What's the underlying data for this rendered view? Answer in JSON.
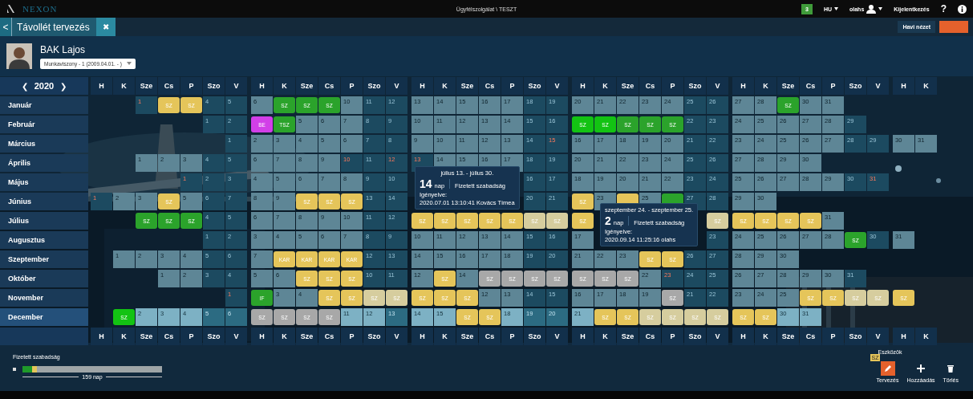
{
  "app": {
    "logo": "NEXON",
    "title": "Ügyfélszolgálat \\ TESZT",
    "notifications": "3",
    "language": "HU",
    "user": "olahs",
    "logout": "Kijelentkezés",
    "help": "?"
  },
  "page_tab": {
    "back": "<",
    "title": "Távollét tervezés",
    "close": "✖"
  },
  "view_button": "Havi nézet",
  "employee": {
    "name": "BAK Lajos",
    "contract": "Munkaviszony - 1 (2009.04.01. - )"
  },
  "year": {
    "prev": "❮",
    "value": "2020",
    "next": "❯"
  },
  "weekdays_top": [
    "H",
    "K",
    "Sze",
    "Cs",
    "P",
    "Szo",
    "V",
    "H",
    "K",
    "Sze",
    "Cs",
    "P",
    "Szo",
    "V",
    "H",
    "K",
    "Sze",
    "Cs",
    "P",
    "Szo",
    "V",
    "H",
    "K",
    "Sze",
    "Cs",
    "P",
    "Szo",
    "V",
    "H",
    "K",
    "Sze",
    "Cs",
    "P",
    "Szo",
    "V",
    "H",
    "K"
  ],
  "weekdays_bottom": [
    "H",
    "K",
    "Sze",
    "Cs",
    "P",
    "Szo",
    "V",
    "H",
    "K",
    "Sze",
    "Cs",
    "P",
    "Szo",
    "V",
    "H",
    "K",
    "Sze",
    "Cs",
    "P",
    "Szo",
    "V",
    "H",
    "K",
    "Sze",
    "Cs",
    "P",
    "Szo",
    "V",
    "H",
    "K",
    "Sze",
    "Cs",
    "P",
    "Szo",
    "V",
    "H",
    "K"
  ],
  "months": [
    {
      "name": "Január",
      "selected": false,
      "days": [
        {
          "kind": "blank"
        },
        {
          "kind": "blank"
        },
        {
          "kind": "holiday",
          "label": "1"
        },
        {
          "kind": "leave",
          "label": "SZ",
          "color": "#e5c55a"
        },
        {
          "kind": "leave",
          "label": "SZ",
          "color": "#e5c55a"
        },
        {
          "kind": "rest",
          "label": "4"
        },
        {
          "kind": "rest",
          "label": "5"
        },
        {
          "kind": "work",
          "label": "6"
        },
        {
          "kind": "leave",
          "label": "SZ",
          "color": "#2ba32b"
        },
        {
          "kind": "leave",
          "label": "SZ",
          "color": "#2ba32b"
        },
        {
          "kind": "leave",
          "label": "SZ",
          "color": "#2ba32b"
        },
        {
          "kind": "work",
          "label": "10"
        },
        {
          "kind": "rest",
          "label": "11"
        },
        {
          "kind": "rest",
          "label": "12"
        },
        {
          "kind": "work",
          "label": "13"
        },
        {
          "kind": "work",
          "label": "14"
        },
        {
          "kind": "work",
          "label": "15"
        },
        {
          "kind": "work",
          "label": "16"
        },
        {
          "kind": "work",
          "label": "17"
        },
        {
          "kind": "rest",
          "label": "18"
        },
        {
          "kind": "rest",
          "label": "19"
        },
        {
          "kind": "work",
          "label": "20"
        },
        {
          "kind": "work",
          "label": "21"
        },
        {
          "kind": "work",
          "label": "22"
        },
        {
          "kind": "work",
          "label": "23"
        },
        {
          "kind": "work",
          "label": "24"
        },
        {
          "kind": "rest",
          "label": "25"
        },
        {
          "kind": "rest",
          "label": "26"
        },
        {
          "kind": "work",
          "label": "27"
        },
        {
          "kind": "work",
          "label": "28"
        },
        {
          "kind": "leave",
          "label": "SZ",
          "color": "#2ba32b"
        },
        {
          "kind": "work",
          "label": "30"
        },
        {
          "kind": "work",
          "label": "31"
        }
      ]
    },
    {
      "name": "Február",
      "selected": false,
      "days": [
        {
          "kind": "blank"
        },
        {
          "kind": "blank"
        },
        {
          "kind": "blank"
        },
        {
          "kind": "blank"
        },
        {
          "kind": "blank"
        },
        {
          "kind": "rest",
          "label": "1"
        },
        {
          "kind": "rest",
          "label": "2"
        },
        {
          "kind": "leave",
          "label": "BE",
          "color": "#d23fe8"
        },
        {
          "kind": "leave",
          "label": "TSZ",
          "color": "#2ba32b"
        },
        {
          "kind": "work",
          "label": "5"
        },
        {
          "kind": "work",
          "label": "6"
        },
        {
          "kind": "work",
          "label": "7"
        },
        {
          "kind": "rest",
          "label": "8"
        },
        {
          "kind": "rest",
          "label": "9"
        },
        {
          "kind": "work",
          "label": "10"
        },
        {
          "kind": "work",
          "label": "11"
        },
        {
          "kind": "work",
          "label": "12"
        },
        {
          "kind": "work",
          "label": "13"
        },
        {
          "kind": "work",
          "label": "14"
        },
        {
          "kind": "rest",
          "label": "15"
        },
        {
          "kind": "rest",
          "label": "16"
        },
        {
          "kind": "leave",
          "label": "SZ",
          "color": "#13c313"
        },
        {
          "kind": "leave",
          "label": "SZ",
          "color": "#13c313"
        },
        {
          "kind": "leave",
          "label": "SZ",
          "color": "#2ba32b"
        },
        {
          "kind": "leave",
          "label": "SZ",
          "color": "#2ba32b"
        },
        {
          "kind": "leave",
          "label": "SZ",
          "color": "#2ba32b"
        },
        {
          "kind": "rest",
          "label": "22"
        },
        {
          "kind": "rest",
          "label": "23"
        },
        {
          "kind": "work",
          "label": "24"
        },
        {
          "kind": "work",
          "label": "25"
        },
        {
          "kind": "work",
          "label": "26"
        },
        {
          "kind": "work",
          "label": "27"
        },
        {
          "kind": "work",
          "label": "28"
        },
        {
          "kind": "rest",
          "label": "29"
        }
      ]
    },
    {
      "name": "Március",
      "selected": false,
      "days": [
        {
          "kind": "blank"
        },
        {
          "kind": "blank"
        },
        {
          "kind": "blank"
        },
        {
          "kind": "blank"
        },
        {
          "kind": "blank"
        },
        {
          "kind": "blank"
        },
        {
          "kind": "rest",
          "label": "1"
        },
        {
          "kind": "work",
          "label": "2"
        },
        {
          "kind": "work",
          "label": "3"
        },
        {
          "kind": "work",
          "label": "4"
        },
        {
          "kind": "work",
          "label": "5"
        },
        {
          "kind": "work",
          "label": "6"
        },
        {
          "kind": "rest",
          "label": "7"
        },
        {
          "kind": "rest",
          "label": "8"
        },
        {
          "kind": "work",
          "label": "9"
        },
        {
          "kind": "work",
          "label": "10"
        },
        {
          "kind": "work",
          "label": "11"
        },
        {
          "kind": "work",
          "label": "12"
        },
        {
          "kind": "work",
          "label": "13"
        },
        {
          "kind": "rest",
          "label": "14"
        },
        {
          "kind": "holiday",
          "label": "15"
        },
        {
          "kind": "work",
          "label": "16"
        },
        {
          "kind": "work",
          "label": "17"
        },
        {
          "kind": "work",
          "label": "18"
        },
        {
          "kind": "work",
          "label": "19"
        },
        {
          "kind": "work",
          "label": "20"
        },
        {
          "kind": "rest",
          "label": "21"
        },
        {
          "kind": "rest",
          "label": "22"
        },
        {
          "kind": "work",
          "label": "23"
        },
        {
          "kind": "work",
          "label": "24"
        },
        {
          "kind": "work",
          "label": "25"
        },
        {
          "kind": "work",
          "label": "26"
        },
        {
          "kind": "work",
          "label": "27"
        },
        {
          "kind": "rest",
          "label": "28"
        },
        {
          "kind": "rest",
          "label": "29"
        },
        {
          "kind": "work",
          "label": "30"
        },
        {
          "kind": "work",
          "label": "31"
        }
      ]
    },
    {
      "name": "Április",
      "selected": false,
      "days": [
        {
          "kind": "blank"
        },
        {
          "kind": "blank"
        },
        {
          "kind": "work",
          "label": "1"
        },
        {
          "kind": "work",
          "label": "2"
        },
        {
          "kind": "work",
          "label": "3"
        },
        {
          "kind": "rest",
          "label": "4"
        },
        {
          "kind": "rest",
          "label": "5"
        },
        {
          "kind": "work",
          "label": "6"
        },
        {
          "kind": "work",
          "label": "7"
        },
        {
          "kind": "work",
          "label": "8"
        },
        {
          "kind": "work",
          "label": "9"
        },
        {
          "kind": "holiday",
          "label": "10"
        },
        {
          "kind": "rest",
          "label": "11"
        },
        {
          "kind": "holiday",
          "label": "12"
        },
        {
          "kind": "holiday",
          "label": "13"
        },
        {
          "kind": "work",
          "label": "14"
        },
        {
          "kind": "work",
          "label": "15"
        },
        {
          "kind": "work",
          "label": "16"
        },
        {
          "kind": "work",
          "label": "17"
        },
        {
          "kind": "rest",
          "label": "18"
        },
        {
          "kind": "rest",
          "label": "19"
        },
        {
          "kind": "work",
          "label": "20"
        },
        {
          "kind": "work",
          "label": "21"
        },
        {
          "kind": "work",
          "label": "22"
        },
        {
          "kind": "work",
          "label": "23"
        },
        {
          "kind": "work",
          "label": "24"
        },
        {
          "kind": "rest",
          "label": "25"
        },
        {
          "kind": "rest",
          "label": "26"
        },
        {
          "kind": "work",
          "label": "27"
        },
        {
          "kind": "work",
          "label": "28"
        },
        {
          "kind": "work",
          "label": "29"
        },
        {
          "kind": "work",
          "label": "30"
        }
      ]
    },
    {
      "name": "Május",
      "selected": false,
      "days": [
        {
          "kind": "blank"
        },
        {
          "kind": "blank"
        },
        {
          "kind": "blank"
        },
        {
          "kind": "blank"
        },
        {
          "kind": "holiday",
          "label": "1"
        },
        {
          "kind": "rest",
          "label": "2"
        },
        {
          "kind": "rest",
          "label": "3"
        },
        {
          "kind": "work",
          "label": "4"
        },
        {
          "kind": "work",
          "label": "5"
        },
        {
          "kind": "work",
          "label": "6"
        },
        {
          "kind": "work",
          "label": "7"
        },
        {
          "kind": "work",
          "label": "8"
        },
        {
          "kind": "rest",
          "label": "9"
        },
        {
          "kind": "rest",
          "label": "10"
        },
        {
          "kind": "covered"
        },
        {
          "kind": "covered"
        },
        {
          "kind": "covered"
        },
        {
          "kind": "covered"
        },
        {
          "kind": "covered"
        },
        {
          "kind": "rest",
          "label": "16"
        },
        {
          "kind": "rest",
          "label": "17"
        },
        {
          "kind": "work",
          "label": "18"
        },
        {
          "kind": "work",
          "label": "19"
        },
        {
          "kind": "work",
          "label": "20"
        },
        {
          "kind": "work",
          "label": "21"
        },
        {
          "kind": "work",
          "label": "22"
        },
        {
          "kind": "rest",
          "label": "23"
        },
        {
          "kind": "rest",
          "label": "24"
        },
        {
          "kind": "work",
          "label": "25"
        },
        {
          "kind": "work",
          "label": "26"
        },
        {
          "kind": "work",
          "label": "27"
        },
        {
          "kind": "work",
          "label": "28"
        },
        {
          "kind": "work",
          "label": "29"
        },
        {
          "kind": "rest",
          "label": "30"
        },
        {
          "kind": "holiday",
          "label": "31"
        }
      ]
    },
    {
      "name": "Június",
      "selected": false,
      "days": [
        {
          "kind": "holiday",
          "label": "1"
        },
        {
          "kind": "work",
          "label": "2"
        },
        {
          "kind": "work",
          "label": "3"
        },
        {
          "kind": "leave",
          "label": "SZ",
          "color": "#e5c55a"
        },
        {
          "kind": "work",
          "label": "5"
        },
        {
          "kind": "rest",
          "label": "6"
        },
        {
          "kind": "rest",
          "label": "7"
        },
        {
          "kind": "work",
          "label": "8"
        },
        {
          "kind": "work",
          "label": "9"
        },
        {
          "kind": "leave",
          "label": "SZ",
          "color": "#e5c55a"
        },
        {
          "kind": "leave",
          "label": "SZ",
          "color": "#e5c55a"
        },
        {
          "kind": "leave",
          "label": "SZ",
          "color": "#e5c55a"
        },
        {
          "kind": "rest",
          "label": "13"
        },
        {
          "kind": "rest",
          "label": "14"
        },
        {
          "kind": "covered"
        },
        {
          "kind": "covered"
        },
        {
          "kind": "covered"
        },
        {
          "kind": "covered"
        },
        {
          "kind": "covered"
        },
        {
          "kind": "rest",
          "label": "20"
        },
        {
          "kind": "rest",
          "label": "21"
        },
        {
          "kind": "leave",
          "label": "SZ",
          "color": "#e5c55a"
        },
        {
          "kind": "work",
          "label": "23"
        },
        {
          "kind": "leave",
          "color": "#e5c55a"
        },
        {
          "kind": "work",
          "label": "25"
        },
        {
          "kind": "leave",
          "color": "#2ba32b"
        },
        {
          "kind": "rest",
          "label": "27"
        },
        {
          "kind": "rest",
          "label": "28"
        },
        {
          "kind": "work",
          "label": "29"
        },
        {
          "kind": "work",
          "label": "30"
        }
      ]
    },
    {
      "name": "Július",
      "selected": false,
      "days": [
        {
          "kind": "blank"
        },
        {
          "kind": "blank"
        },
        {
          "kind": "leave",
          "label": "SZ",
          "color": "#2ba32b"
        },
        {
          "kind": "leave",
          "label": "SZ",
          "color": "#2ba32b"
        },
        {
          "kind": "leave",
          "label": "SZ",
          "color": "#2ba32b"
        },
        {
          "kind": "rest",
          "label": "4"
        },
        {
          "kind": "rest",
          "label": "5"
        },
        {
          "kind": "work",
          "label": "6"
        },
        {
          "kind": "work",
          "label": "7"
        },
        {
          "kind": "work",
          "label": "8"
        },
        {
          "kind": "work",
          "label": "9"
        },
        {
          "kind": "work",
          "label": "10"
        },
        {
          "kind": "rest",
          "label": "11"
        },
        {
          "kind": "rest",
          "label": "12"
        },
        {
          "kind": "leave",
          "label": "SZ",
          "color": "#e5c55a"
        },
        {
          "kind": "leave",
          "label": "SZ",
          "color": "#e5c55a"
        },
        {
          "kind": "leave",
          "label": "SZ",
          "color": "#e5c55a"
        },
        {
          "kind": "leave",
          "label": "SZ",
          "color": "#e5c55a"
        },
        {
          "kind": "leave",
          "label": "SZ",
          "color": "#e5c55a"
        },
        {
          "kind": "leave",
          "label": "SZ",
          "color": "#d6cd9e"
        },
        {
          "kind": "leave",
          "label": "SZ",
          "color": "#d6cd9e"
        },
        {
          "kind": "leave",
          "label": "SZ",
          "color": "#e5c55a"
        },
        {
          "kind": "covered"
        },
        {
          "kind": "covered"
        },
        {
          "kind": "covered"
        },
        {
          "kind": "covered"
        },
        {
          "kind": "covered"
        },
        {
          "kind": "leave",
          "label": "SZ",
          "color": "#d6cd9e"
        },
        {
          "kind": "leave",
          "label": "SZ",
          "color": "#e5c55a"
        },
        {
          "kind": "leave",
          "label": "SZ",
          "color": "#e5c55a"
        },
        {
          "kind": "leave",
          "label": "SZ",
          "color": "#e5c55a"
        },
        {
          "kind": "leave",
          "label": "SZ",
          "color": "#e5c55a"
        },
        {
          "kind": "work",
          "label": "31"
        }
      ]
    },
    {
      "name": "Augusztus",
      "selected": false,
      "days": [
        {
          "kind": "blank"
        },
        {
          "kind": "blank"
        },
        {
          "kind": "blank"
        },
        {
          "kind": "blank"
        },
        {
          "kind": "blank"
        },
        {
          "kind": "rest",
          "label": "1"
        },
        {
          "kind": "rest",
          "label": "2"
        },
        {
          "kind": "work",
          "label": "3"
        },
        {
          "kind": "work",
          "label": "4"
        },
        {
          "kind": "work",
          "label": "5"
        },
        {
          "kind": "work",
          "label": "6"
        },
        {
          "kind": "work",
          "label": "7"
        },
        {
          "kind": "rest",
          "label": "8"
        },
        {
          "kind": "rest",
          "label": "9"
        },
        {
          "kind": "work",
          "label": "10"
        },
        {
          "kind": "work",
          "label": "11"
        },
        {
          "kind": "work",
          "label": "12"
        },
        {
          "kind": "work",
          "label": "13"
        },
        {
          "kind": "work",
          "label": "14"
        },
        {
          "kind": "rest",
          "label": "15"
        },
        {
          "kind": "rest",
          "label": "16"
        },
        {
          "kind": "work",
          "label": "17"
        },
        {
          "kind": "covered"
        },
        {
          "kind": "covered"
        },
        {
          "kind": "covered"
        },
        {
          "kind": "covered"
        },
        {
          "kind": "covered"
        },
        {
          "kind": "rest",
          "label": "23"
        },
        {
          "kind": "work",
          "label": "24"
        },
        {
          "kind": "work",
          "label": "25"
        },
        {
          "kind": "work",
          "label": "26"
        },
        {
          "kind": "work",
          "label": "27"
        },
        {
          "kind": "work",
          "label": "28"
        },
        {
          "kind": "leave",
          "label": "SZ",
          "color": "#2ba32b"
        },
        {
          "kind": "rest",
          "label": "30"
        },
        {
          "kind": "work",
          "label": "31"
        }
      ]
    },
    {
      "name": "Szeptember",
      "selected": false,
      "days": [
        {
          "kind": "blank"
        },
        {
          "kind": "work",
          "label": "1"
        },
        {
          "kind": "work",
          "label": "2"
        },
        {
          "kind": "work",
          "label": "3"
        },
        {
          "kind": "work",
          "label": "4"
        },
        {
          "kind": "rest",
          "label": "5"
        },
        {
          "kind": "rest",
          "label": "6"
        },
        {
          "kind": "work",
          "label": "7"
        },
        {
          "kind": "leave",
          "label": "KAR",
          "color": "#e5c55a"
        },
        {
          "kind": "leave",
          "label": "KAR",
          "color": "#e5c55a"
        },
        {
          "kind": "leave",
          "label": "KAR",
          "color": "#e5c55a"
        },
        {
          "kind": "leave",
          "label": "KAR",
          "color": "#e5c55a"
        },
        {
          "kind": "rest",
          "label": "12"
        },
        {
          "kind": "rest",
          "label": "13"
        },
        {
          "kind": "work",
          "label": "14"
        },
        {
          "kind": "work",
          "label": "15"
        },
        {
          "kind": "work",
          "label": "16"
        },
        {
          "kind": "work",
          "label": "17"
        },
        {
          "kind": "work",
          "label": "18"
        },
        {
          "kind": "rest",
          "label": "19"
        },
        {
          "kind": "rest",
          "label": "20"
        },
        {
          "kind": "work",
          "label": "21"
        },
        {
          "kind": "work",
          "label": "22"
        },
        {
          "kind": "work",
          "label": "23"
        },
        {
          "kind": "leave",
          "label": "SZ",
          "color": "#e5c55a"
        },
        {
          "kind": "leave",
          "label": "SZ",
          "color": "#e5c55a"
        },
        {
          "kind": "rest",
          "label": "26"
        },
        {
          "kind": "rest",
          "label": "27"
        },
        {
          "kind": "work",
          "label": "28"
        },
        {
          "kind": "work",
          "label": "29"
        },
        {
          "kind": "work",
          "label": "30"
        }
      ]
    },
    {
      "name": "Október",
      "selected": false,
      "days": [
        {
          "kind": "blank"
        },
        {
          "kind": "blank"
        },
        {
          "kind": "blank"
        },
        {
          "kind": "work",
          "label": "1"
        },
        {
          "kind": "work",
          "label": "2"
        },
        {
          "kind": "rest",
          "label": "3"
        },
        {
          "kind": "rest",
          "label": "4"
        },
        {
          "kind": "work",
          "label": "5"
        },
        {
          "kind": "work",
          "label": "6"
        },
        {
          "kind": "leave",
          "label": "SZ",
          "color": "#e5c55a"
        },
        {
          "kind": "leave",
          "label": "SZ",
          "color": "#e5c55a"
        },
        {
          "kind": "leave",
          "label": "SZ",
          "color": "#e5c55a"
        },
        {
          "kind": "rest",
          "label": "10"
        },
        {
          "kind": "rest",
          "label": "11"
        },
        {
          "kind": "work",
          "label": "12"
        },
        {
          "kind": "leave",
          "label": "SZ",
          "color": "#e5c55a"
        },
        {
          "kind": "work",
          "label": "14"
        },
        {
          "kind": "leave",
          "label": "SZ",
          "color": "#a8a8a8"
        },
        {
          "kind": "leave",
          "label": "SZ",
          "color": "#a8a8a8"
        },
        {
          "kind": "leave",
          "label": "SZ",
          "color": "#a8a8a8"
        },
        {
          "kind": "leave",
          "label": "SZ",
          "color": "#a8a8a8"
        },
        {
          "kind": "leave",
          "label": "SZ",
          "color": "#a8a8a8"
        },
        {
          "kind": "leave",
          "label": "SZ",
          "color": "#a8a8a8"
        },
        {
          "kind": "leave",
          "label": "SZ",
          "color": "#a8a8a8"
        },
        {
          "kind": "work",
          "label": "22"
        },
        {
          "kind": "holiday",
          "label": "23"
        },
        {
          "kind": "rest",
          "label": "24"
        },
        {
          "kind": "rest",
          "label": "25"
        },
        {
          "kind": "work",
          "label": "26"
        },
        {
          "kind": "work",
          "label": "27"
        },
        {
          "kind": "work",
          "label": "28"
        },
        {
          "kind": "work",
          "label": "29"
        },
        {
          "kind": "work",
          "label": "30"
        },
        {
          "kind": "rest",
          "label": "31"
        }
      ]
    },
    {
      "name": "November",
      "selected": false,
      "days": [
        {
          "kind": "blank"
        },
        {
          "kind": "blank"
        },
        {
          "kind": "blank"
        },
        {
          "kind": "blank"
        },
        {
          "kind": "blank"
        },
        {
          "kind": "blank"
        },
        {
          "kind": "holiday",
          "label": "1"
        },
        {
          "kind": "leave",
          "label": "IF",
          "color": "#2ba32b"
        },
        {
          "kind": "work",
          "label": "3"
        },
        {
          "kind": "work",
          "label": "4"
        },
        {
          "kind": "leave",
          "label": "SZ",
          "color": "#e5c55a"
        },
        {
          "kind": "leave",
          "label": "SZ",
          "color": "#e5c55a"
        },
        {
          "kind": "leave",
          "label": "SZ",
          "color": "#d6cd9e"
        },
        {
          "kind": "leave",
          "label": "SZ",
          "color": "#d6cd9e"
        },
        {
          "kind": "leave",
          "label": "SZ",
          "color": "#e5c55a"
        },
        {
          "kind": "leave",
          "label": "SZ",
          "color": "#e5c55a"
        },
        {
          "kind": "leave",
          "label": "SZ",
          "color": "#e5c55a"
        },
        {
          "kind": "work",
          "label": "12"
        },
        {
          "kind": "work",
          "label": "13"
        },
        {
          "kind": "rest",
          "label": "14"
        },
        {
          "kind": "rest",
          "label": "15"
        },
        {
          "kind": "work",
          "label": "16"
        },
        {
          "kind": "work",
          "label": "17"
        },
        {
          "kind": "work",
          "label": "18"
        },
        {
          "kind": "work",
          "label": "19"
        },
        {
          "kind": "leave",
          "label": "SZ",
          "color": "#a8a8a8"
        },
        {
          "kind": "rest",
          "label": "21"
        },
        {
          "kind": "rest",
          "label": "22"
        },
        {
          "kind": "work",
          "label": "23"
        },
        {
          "kind": "work",
          "label": "24"
        },
        {
          "kind": "work",
          "label": "25"
        },
        {
          "kind": "leave",
          "label": "SZ",
          "color": "#e5c55a"
        },
        {
          "kind": "leave",
          "label": "SZ",
          "color": "#e5c55a"
        },
        {
          "kind": "leave",
          "label": "SZ",
          "color": "#d6cd9e"
        },
        {
          "kind": "leave",
          "label": "SZ",
          "color": "#d6cd9e"
        },
        {
          "kind": "leave",
          "label": "SZ",
          "color": "#e5c55a"
        }
      ]
    },
    {
      "name": "December",
      "selected": true,
      "days": [
        {
          "kind": "blank"
        },
        {
          "kind": "leave",
          "label": "SZ",
          "color": "#13c313"
        },
        {
          "kind": "work",
          "label": "2"
        },
        {
          "kind": "work",
          "label": "3"
        },
        {
          "kind": "work",
          "label": "4"
        },
        {
          "kind": "rest",
          "label": "5"
        },
        {
          "kind": "rest",
          "label": "6"
        },
        {
          "kind": "leave",
          "label": "SZ",
          "color": "#a8a8a8"
        },
        {
          "kind": "leave",
          "label": "SZ",
          "color": "#a8a8a8"
        },
        {
          "kind": "leave",
          "label": "SZ",
          "color": "#a8a8a8"
        },
        {
          "kind": "leave",
          "label": "SZ",
          "color": "#a8a8a8"
        },
        {
          "kind": "work",
          "label": "11"
        },
        {
          "kind": "work",
          "label": "12"
        },
        {
          "kind": "rest",
          "label": "13"
        },
        {
          "kind": "work",
          "label": "14"
        },
        {
          "kind": "work",
          "label": "15"
        },
        {
          "kind": "leave",
          "label": "SZ",
          "color": "#e5c55a"
        },
        {
          "kind": "leave",
          "label": "SZ",
          "color": "#e5c55a"
        },
        {
          "kind": "work",
          "label": "18"
        },
        {
          "kind": "rest",
          "label": "19"
        },
        {
          "kind": "rest",
          "label": "20"
        },
        {
          "kind": "work",
          "label": "21"
        },
        {
          "kind": "leave",
          "label": "SZ",
          "color": "#e5c55a"
        },
        {
          "kind": "leave",
          "label": "SZ",
          "color": "#e5c55a"
        },
        {
          "kind": "leave",
          "label": "SZ",
          "color": "#d6cd9e"
        },
        {
          "kind": "leave",
          "label": "SZ",
          "color": "#d6cd9e"
        },
        {
          "kind": "leave",
          "label": "SZ",
          "color": "#d6cd9e"
        },
        {
          "kind": "leave",
          "label": "SZ",
          "color": "#d6cd9e"
        },
        {
          "kind": "leave",
          "label": "SZ",
          "color": "#e5c55a"
        },
        {
          "kind": "leave",
          "label": "SZ",
          "color": "#e5c55a"
        },
        {
          "kind": "work",
          "label": "30"
        },
        {
          "kind": "work",
          "label": "31"
        }
      ]
    }
  ],
  "tooltips": [
    {
      "range": "július 13. - július 30.",
      "days": "14",
      "unit": "nap",
      "type": "Fizetett szabadság",
      "requested_label": "Igényelve:",
      "requested_detail": "2020.07.01 13:10:41 Kovács Tímea"
    },
    {
      "range": "szeptember 24. - szeptember 25.",
      "days": "2",
      "unit": "nap",
      "type": "Fizetett szabadság",
      "requested_label": "Igényelve:",
      "requested_detail": "2020.09.14 11:25:16 olahs"
    }
  ],
  "summary": {
    "title": "Fizetett szabadság",
    "total": "159 nap",
    "segments": [
      {
        "color": "#1f9a2a",
        "level": 0.07
      },
      {
        "color": "#e5c55a",
        "level": 0.035
      }
    ]
  },
  "tools": {
    "title": "Eszközök",
    "items": [
      {
        "kind": "pencil",
        "label": "Tervezés",
        "selected": true,
        "badge": "SZ"
      },
      {
        "kind": "plus",
        "label": "Hozzáadás",
        "selected": false
      },
      {
        "kind": "trash",
        "label": "Törlés",
        "selected": false
      }
    ]
  }
}
